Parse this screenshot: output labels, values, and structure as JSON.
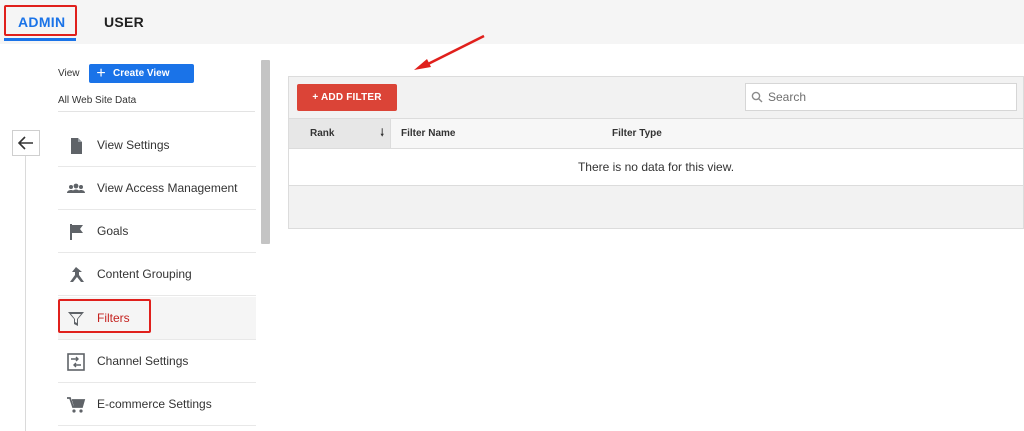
{
  "tabs": {
    "admin": "ADMIN",
    "user": "USER"
  },
  "sidebar": {
    "view_label": "View",
    "create_view_label": "Create View",
    "account_label": "All Web Site Data",
    "items": [
      {
        "label": "View Settings",
        "icon": "document-icon"
      },
      {
        "label": "View Access Management",
        "icon": "people-icon"
      },
      {
        "label": "Goals",
        "icon": "flag-icon"
      },
      {
        "label": "Content Grouping",
        "icon": "content-grouping-icon"
      },
      {
        "label": "Filters",
        "icon": "filter-icon",
        "active": true
      },
      {
        "label": "Channel Settings",
        "icon": "channel-settings-icon"
      },
      {
        "label": "E-commerce Settings",
        "icon": "cart-icon"
      }
    ]
  },
  "main": {
    "add_filter_label": "+ ADD FILTER",
    "search_placeholder": "Search",
    "columns": [
      "Rank",
      "Filter Name",
      "Filter Type"
    ],
    "empty_message": "There is no data for this view."
  },
  "colors": {
    "accent_blue": "#1a73e8",
    "add_filter_red": "#db4437",
    "annotation_red": "#e0201c",
    "active_label_red": "#c5221f"
  }
}
